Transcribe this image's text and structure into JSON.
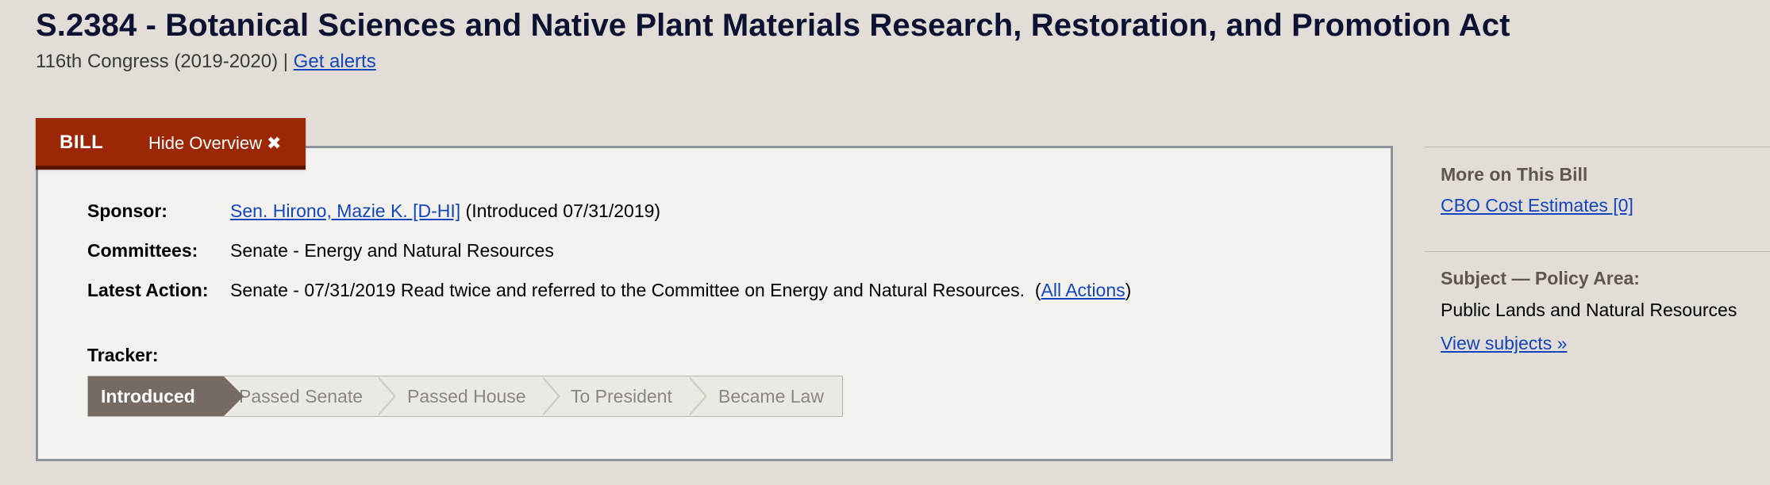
{
  "bill": {
    "title": "S.2384 - Botanical Sciences and Native Plant Materials Research, Restoration, and Promotion Act",
    "congress": "116th Congress (2019-2020)",
    "separator": "|",
    "get_alerts": "Get alerts"
  },
  "tab": {
    "label": "BILL",
    "hide_overview": "Hide Overview",
    "close_glyph": "✖"
  },
  "overview": {
    "sponsor_label": "Sponsor:",
    "sponsor_name": "Sen. Hirono, Mazie K. [D-HI]",
    "sponsor_introduced": "(Introduced 07/31/2019)",
    "committees_label": "Committees:",
    "committees_value": "Senate - Energy and Natural Resources",
    "latest_action_label": "Latest Action:",
    "latest_action_value": "Senate - 07/31/2019 Read twice and referred to the Committee on Energy and Natural Resources.",
    "all_actions_open": "(",
    "all_actions_link": "All Actions",
    "all_actions_close": ")",
    "tracker_label": "Tracker:",
    "tracker_steps": [
      "Introduced",
      "Passed Senate",
      "Passed House",
      "To President",
      "Became Law"
    ],
    "tracker_current": "Introduced"
  },
  "sidebar": {
    "more_heading": "More on This Bill",
    "cbo_link": "CBO Cost Estimates [0]",
    "subject_heading": "Subject — Policy Area:",
    "policy_area": "Public Lands and Natural Resources",
    "view_subjects": "View subjects",
    "view_subjects_glyph": "»"
  },
  "colors": {
    "tab_bg": "#9b2706",
    "link": "#1346bd",
    "tracker_active": "#756b64",
    "page_bg": "#e2ddd6",
    "panel_bg": "#f4f2ee"
  }
}
